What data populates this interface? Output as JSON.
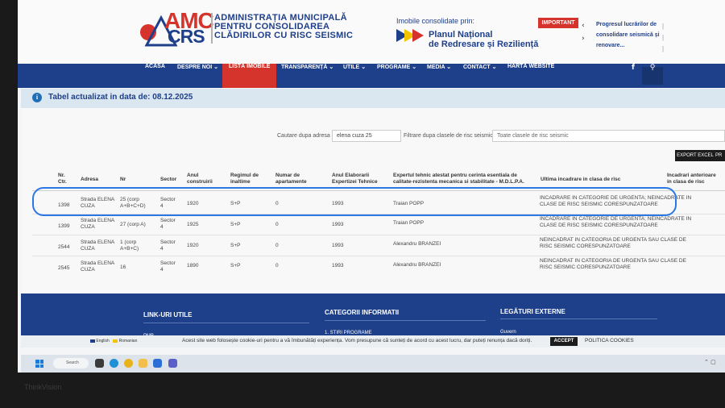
{
  "header": {
    "logo_amc": "AMC",
    "logo_crs": "CRS",
    "logo_line1": "ADMINISTRAȚIA MUNICIPALĂ",
    "logo_line2": "PENTRU CONSOLIDAREA",
    "logo_line3": "CLĂDIRILOR CU RISC SEISMIC",
    "pnrr_intro": "Imobile consolidate prin:",
    "pnrr_line1": "Planul Național",
    "pnrr_line2": "de Redresare și Reziliență",
    "important_badge": "IMPORTANT",
    "news_line1": "Progresul lucrărilor de",
    "news_line2": "consolidare seismică și",
    "news_line3": "renovare..."
  },
  "nav": {
    "items": [
      "ACASĂ",
      "DESPRE NOI",
      "LISTĂ IMOBILE",
      "TRANSPARENȚĂ",
      "UTILE",
      "PROGRAME",
      "MEDIA",
      "CONTACT",
      "HARTĂ WEBSITE"
    ],
    "facebook": "f",
    "search": "⚲"
  },
  "info_bar": {
    "text": "Tabel actualizat in data de: 08.12.2025"
  },
  "search": {
    "label": "Cautare dupa adresa",
    "value": "elena cuza 25",
    "filter_label": "Filtrare dupa clasele de risc seismic",
    "filter_value": "Toate clasele de risc seismic"
  },
  "buttons": {
    "export": "EXPORT EXCEL",
    "print": "PR"
  },
  "table": {
    "headers": {
      "nr_ctr_1": "Nr.",
      "nr_ctr_2": "Ctr.",
      "adresa": "Adresa",
      "nr": "Nr",
      "sector": "Sector",
      "anul_1": "Anul",
      "anul_2": "construirii",
      "regim_1": "Regimul de",
      "regim_2": "inaltime",
      "apart_1": "Numar de",
      "apart_2": "apartamente",
      "elab_1": "Anul Elaborarii",
      "elab_2": "Expertizei Tehnice",
      "expert_1": "Expertul tehnic atestat pentru cerinta esentiala de",
      "expert_2": "calitate-rezistenta mecanica si stabilitate - M.D.L.P.A.",
      "clasa": "Ultima incadrare in clasa de risc",
      "ant_1": "Incadrari anterioare",
      "ant_2": "in clasa de risc"
    },
    "rows": [
      {
        "nr_ctr": "1398",
        "adresa_1": "Strada ELENA",
        "adresa_2": "CUZA",
        "nr_1": "25 (corp",
        "nr_2": "A+B+C+D)",
        "sector_1": "Sector",
        "sector_2": "4",
        "anul": "1920",
        "regim": "S+P",
        "apart": "0",
        "elab": "1993",
        "expert": "Traian POPP",
        "clasa_1": "INCADRARE IN CATEGORIE DE URGENTA; NEINCADRATE IN",
        "clasa_2": "CLASE DE RISC SEISMIC CORESPUNZATOARE"
      },
      {
        "nr_ctr": "1399",
        "adresa_1": "Strada ELENA",
        "adresa_2": "CUZA",
        "nr_1": "27 (corp A)",
        "nr_2": "",
        "sector_1": "Sector",
        "sector_2": "4",
        "anul": "1925",
        "regim": "S+P",
        "apart": "0",
        "elab": "1993",
        "expert": "Traian POPP",
        "clasa_1": "INCADRARE IN CATEGORIE DE URGENTA; NEINCADRATE IN",
        "clasa_2": "CLASE DE RISC SEISMIC CORESPUNZATOARE"
      },
      {
        "nr_ctr": "2544",
        "adresa_1": "Strada ELENA",
        "adresa_2": "CUZA",
        "nr_1": "1 (corp",
        "nr_2": "A+B+C)",
        "sector_1": "Sector",
        "sector_2": "4",
        "anul": "1920",
        "regim": "S+P",
        "apart": "0",
        "elab": "1993",
        "expert": "Alexandru BRANZEI",
        "clasa_1": "NEINCADRAT IN CATEGORIA DE URGENTA SAU CLASE DE",
        "clasa_2": "RISC SEISMIC CORESPUNZATOARE"
      },
      {
        "nr_ctr": "2545",
        "adresa_1": "Strada ELENA",
        "adresa_2": "CUZA",
        "nr_1": "16",
        "nr_2": "",
        "sector_1": "Sector",
        "sector_2": "4",
        "anul": "1890",
        "regim": "S+P",
        "apart": "0",
        "elab": "1993",
        "expert": "Alexandru BRANZEI",
        "clasa_1": "NEINCADRAT IN CATEGORIA DE URGENTA SAU CLASE DE",
        "clasa_2": "RISC SEISMIC CORESPUNZATOARE"
      }
    ]
  },
  "footer": {
    "links_heading": "LINK-URI UTILE",
    "links_item": "PMB",
    "categories_heading": "CATEGORII INFORMATII",
    "categories_item": "1. STIRI PROGRAME",
    "external_heading": "LEGĂTURI EXTERNE",
    "external_item": "Guvern"
  },
  "cookie": {
    "lang_en": "English",
    "lang_ro": "Romanian",
    "text": "Acest site web folosește cookie-uri pentru a vă îmbunătăți experiența. Vom presupune că sunteți de acord cu acest lucru, dar puteți renunța dacă doriți.",
    "accept": "ACCEPT",
    "policy": "POLITICA COOKIES"
  },
  "taskbar": {
    "search": "Search"
  },
  "bezel": {
    "brand": "ThinkVision"
  },
  "colors": {
    "brand_blue": "#1e3f8a",
    "brand_red": "#d4342c",
    "highlight": "#2b78e4"
  }
}
